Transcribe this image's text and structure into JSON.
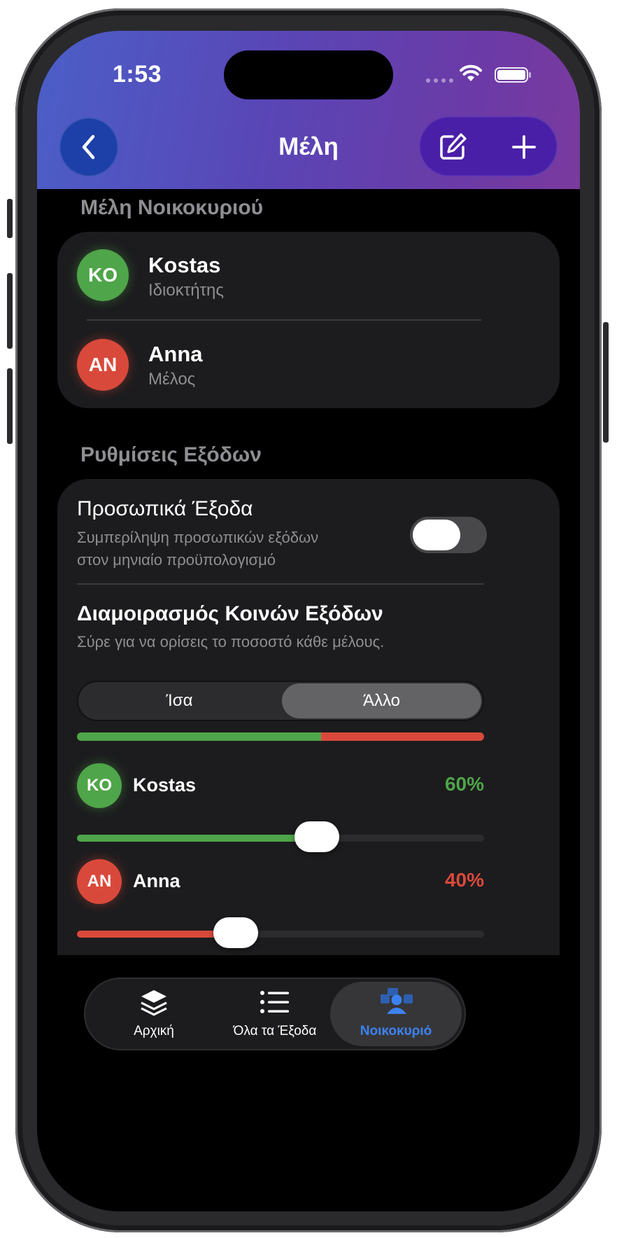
{
  "status": {
    "time": "1:53"
  },
  "nav": {
    "title": "Μέλη",
    "back_icon": "chevron-left-icon",
    "edit_icon": "square-pencil-icon",
    "add_icon": "plus-icon"
  },
  "members_section": {
    "title": "Μέλη Νοικοκυριού",
    "members": [
      {
        "initials": "KO",
        "name": "Kostas",
        "role": "Ιδιοκτήτης",
        "color": "#4fa549"
      },
      {
        "initials": "AN",
        "name": "Anna",
        "role": "Μέλος",
        "color": "#d9493b"
      }
    ]
  },
  "expenses_section": {
    "title": "Ρυθμίσεις Εξόδων",
    "personal": {
      "title": "Προσωπικά Έξοδα",
      "desc_line1": "Συμπερίληψη προσωπικών εξόδων",
      "desc_line2": "στον μηνιαίο προϋπολογισμό",
      "enabled": false
    },
    "split": {
      "title": "Διαμοιρασμός Κοινών Εξόδων",
      "subtitle": "Σύρε για να ορίσεις το ποσοστό κάθε μέλους.",
      "options": [
        "Ίσα",
        "Άλλο"
      ],
      "selected": "Άλλο",
      "shares": [
        {
          "initials": "KO",
          "name": "Kostas",
          "percent_label": "60%",
          "value": 0.6,
          "color": "#4fa549"
        },
        {
          "initials": "AN",
          "name": "Anna",
          "percent_label": "40%",
          "value": 0.4,
          "color": "#d9493b"
        }
      ]
    }
  },
  "tabbar": {
    "tabs": [
      {
        "label": "Αρχική",
        "icon": "layers-icon"
      },
      {
        "label": "Όλα τα Έξοδα",
        "icon": "list-icon"
      },
      {
        "label": "Νοικοκυριό",
        "icon": "household-icon"
      }
    ],
    "active_index": 2,
    "active_color": "#3d82f0"
  },
  "colors": {
    "header_start": "#4b5fc8",
    "header_end": "#7a3a9e",
    "card": "#1c1c1e",
    "green": "#4fa549",
    "red": "#d9493b"
  }
}
